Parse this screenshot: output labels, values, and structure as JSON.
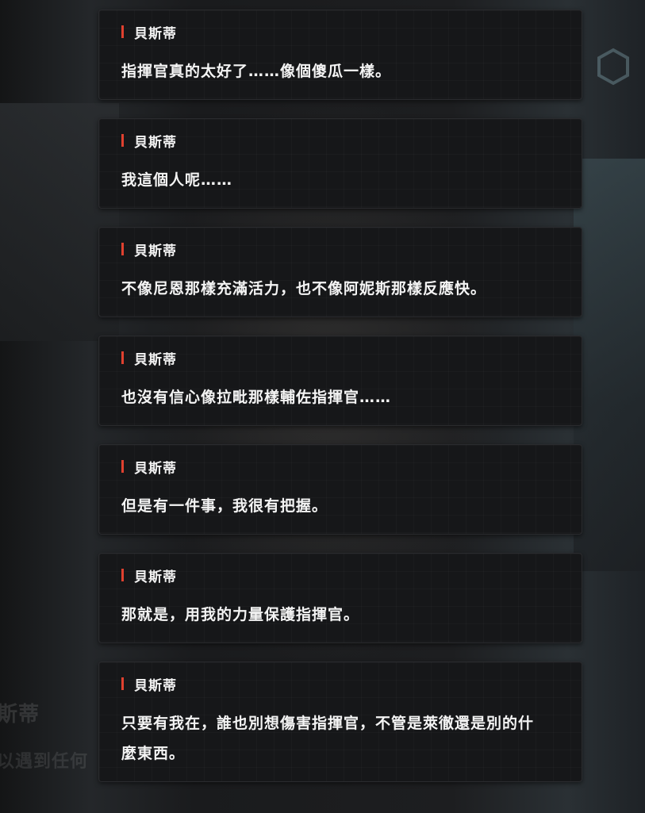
{
  "speaker_color": "#e0412f",
  "entries": [
    {
      "speaker": "貝斯蒂",
      "text": "指揮官真的太好了……像個傻瓜一樣。"
    },
    {
      "speaker": "貝斯蒂",
      "text": "我這個人呢……"
    },
    {
      "speaker": "貝斯蒂",
      "text": "不像尼恩那樣充滿活力，也不像阿妮斯那樣反應快。"
    },
    {
      "speaker": "貝斯蒂",
      "text": "也沒有信心像拉毗那樣輔佐指揮官……"
    },
    {
      "speaker": "貝斯蒂",
      "text": "但是有一件事，我很有把握。"
    },
    {
      "speaker": "貝斯蒂",
      "text": "那就是，用我的力量保護指揮官。"
    },
    {
      "speaker": "貝斯蒂",
      "text": "只要有我在，誰也別想傷害指揮官，不管是萊徹還是別的什麼東西。"
    }
  ],
  "background": {
    "ghost_name": "斯蒂",
    "ghost_line": "以遇到任何"
  }
}
